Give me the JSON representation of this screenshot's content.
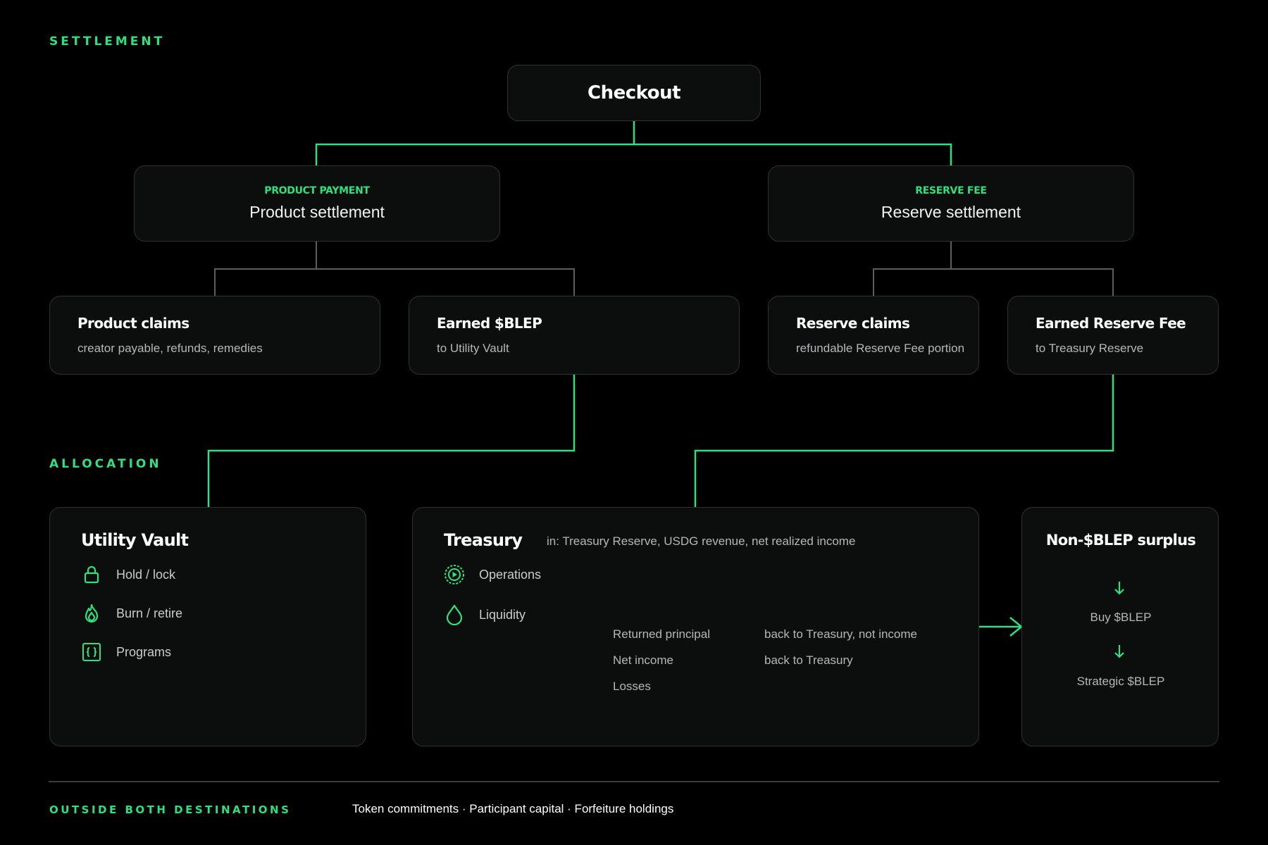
{
  "sections": {
    "settlement": "SETTLEMENT",
    "allocation": "ALLOCATION",
    "outside": "OUTSIDE BOTH DESTINATIONS"
  },
  "checkout": {
    "title": "Checkout"
  },
  "product_payment": {
    "tag": "PRODUCT PAYMENT",
    "title": "Product settlement"
  },
  "reserve_fee": {
    "tag": "RESERVE FEE",
    "title": "Reserve settlement"
  },
  "leaves": {
    "product_claims": {
      "title": "Product claims",
      "subtitle": "creator payable, refunds, remedies"
    },
    "earned_blep": {
      "title": "Earned $BLEP",
      "subtitle": "to Utility Vault"
    },
    "reserve_claims": {
      "title": "Reserve claims",
      "subtitle": "refundable Reserve Fee portion"
    },
    "earned_reserve_fee": {
      "title": "Earned Reserve Fee",
      "subtitle": "to Treasury Reserve"
    }
  },
  "utility_vault": {
    "title": "Utility Vault",
    "items": [
      {
        "icon": "lock-icon",
        "label": "Hold / lock"
      },
      {
        "icon": "flame-icon",
        "label": "Burn / retire"
      },
      {
        "icon": "braces-icon",
        "label": "Programs"
      }
    ]
  },
  "treasury": {
    "title": "Treasury",
    "inflows": "in: Treasury Reserve, USDG revenue, net realized income",
    "operations": "Operations",
    "liquidity": "Liquidity",
    "liquidity_outcomes": [
      {
        "label": "Returned principal",
        "note": "back to Treasury, not income"
      },
      {
        "label": "Net income",
        "note": "back to Treasury"
      },
      {
        "label": "Losses",
        "note": ""
      }
    ]
  },
  "surplus": {
    "title": "Non-$BLEP surplus",
    "step1": "Buy $BLEP",
    "step2": "Strategic $BLEP"
  },
  "footer": {
    "items": "Token commitments · Participant capital · Forfeiture holdings"
  },
  "colors": {
    "accent": "#2ee07e",
    "box_bg": "#0c0d0d",
    "box_border": "#2e3232",
    "connector_gray": "#5a5e5e"
  }
}
